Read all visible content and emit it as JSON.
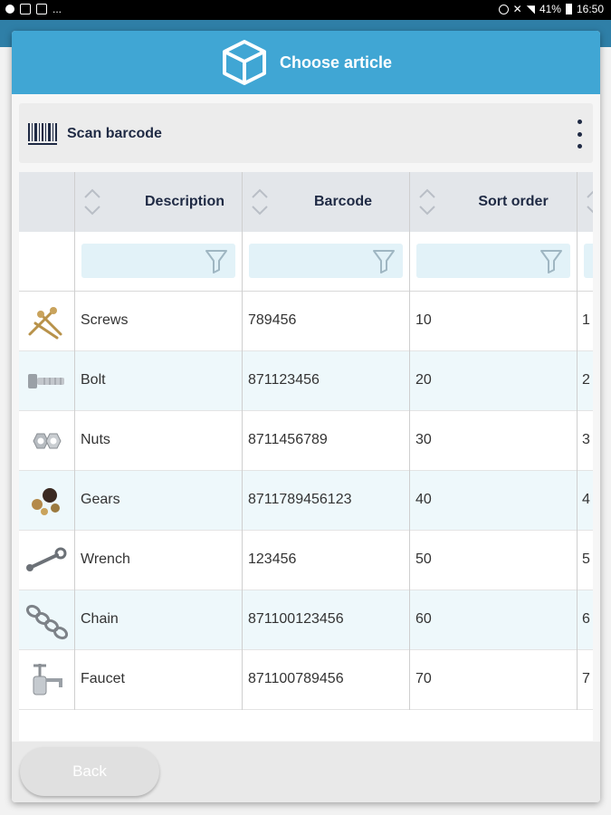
{
  "status_bar": {
    "battery": "41%",
    "time": "16:50",
    "dots": "..."
  },
  "dialog": {
    "title": "Choose article",
    "scan_label": "Scan barcode",
    "columns": [
      "Description",
      "Barcode",
      "Sort order"
    ],
    "extra_column_partial": "",
    "rows": [
      {
        "description": "Screws",
        "barcode": "789456",
        "sort_order": "10",
        "extra": "1",
        "icon": "screws-icon"
      },
      {
        "description": "Bolt",
        "barcode": "871123456",
        "sort_order": "20",
        "extra": "2",
        "icon": "bolt-icon"
      },
      {
        "description": "Nuts",
        "barcode": "8711456789",
        "sort_order": "30",
        "extra": "3",
        "icon": "nuts-icon"
      },
      {
        "description": "Gears",
        "barcode": "8711789456123",
        "sort_order": "40",
        "extra": "4",
        "icon": "gears-icon"
      },
      {
        "description": "Wrench",
        "barcode": "123456",
        "sort_order": "50",
        "extra": "5",
        "icon": "wrench-icon"
      },
      {
        "description": "Chain",
        "barcode": "871100123456",
        "sort_order": "60",
        "extra": "6",
        "icon": "chain-icon"
      },
      {
        "description": "Faucet",
        "barcode": "871100789456",
        "sort_order": "70",
        "extra": "7",
        "icon": "faucet-icon"
      }
    ],
    "back_label": "Back"
  },
  "colors": {
    "header": "#40a6d4",
    "row_alt": "#eef8fb",
    "filter_box": "#e2f2f8"
  }
}
